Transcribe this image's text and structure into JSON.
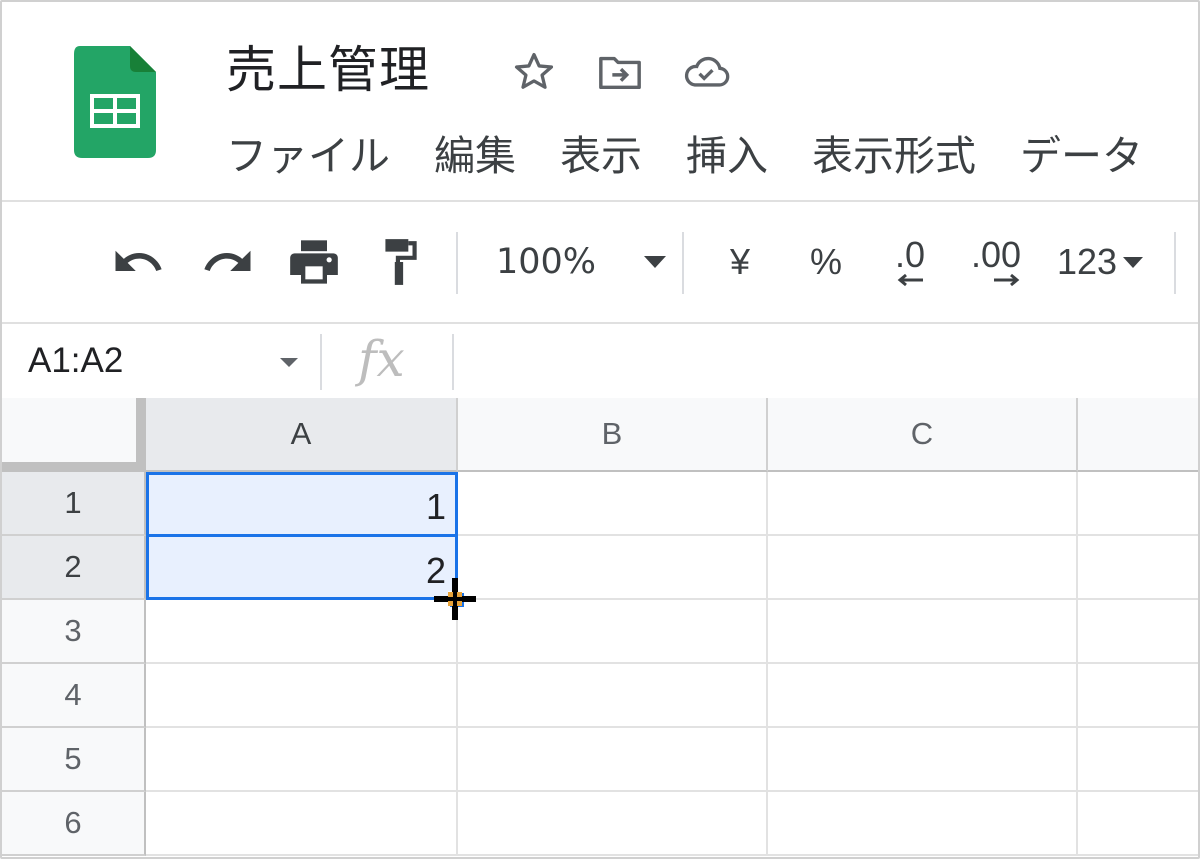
{
  "header": {
    "title": "売上管理",
    "icons": [
      "star-icon",
      "move-to-folder-icon",
      "cloud-saved-icon"
    ],
    "menu": [
      "ファイル",
      "編集",
      "表示",
      "挿入",
      "表示形式",
      "データ"
    ]
  },
  "toolbar": {
    "zoom": "100%",
    "currency": "¥",
    "percent": "%",
    "decrease_decimal": ".0",
    "increase_decimal": ".00",
    "more_formats": "123"
  },
  "formula_bar": {
    "name_box": "A1:A2",
    "fx": "fx",
    "content": ""
  },
  "grid": {
    "columns": [
      "A",
      "B",
      "C"
    ],
    "rows": [
      "1",
      "2",
      "3",
      "4",
      "5",
      "6"
    ],
    "cells": {
      "A1": "1",
      "A2": "2"
    }
  },
  "colors": {
    "selection_border": "#1a73e8",
    "selection_fill": "#e8f0fe",
    "sheets_green": "#0f9d58"
  }
}
